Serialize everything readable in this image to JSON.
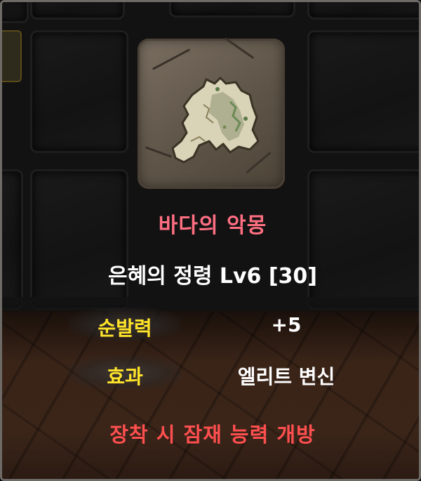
{
  "item": {
    "icon": "map-fragment-icon",
    "name": "바다의 악몽",
    "subtitle": "은혜의 정령 Lv6 [30]"
  },
  "stats": [
    {
      "label": "순발력",
      "value": "+5"
    },
    {
      "label": "효과",
      "value": "엘리트 변신"
    }
  ],
  "footer": "장착 시 잠재 능력 개방",
  "colors": {
    "name": "#ff6f82",
    "stat_label": "#ffe42a",
    "footer": "#ff4f4f"
  }
}
